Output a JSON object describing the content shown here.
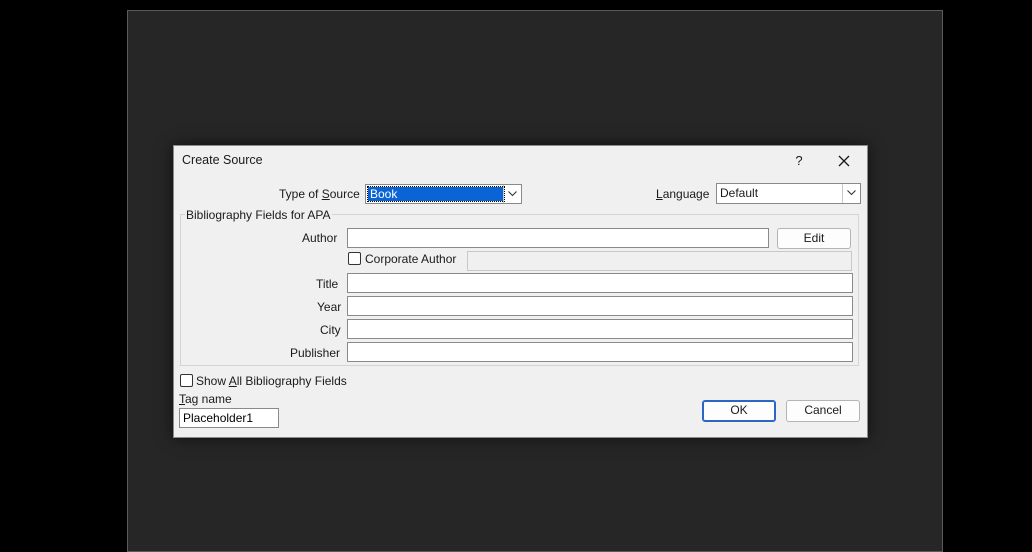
{
  "dialog": {
    "title": "Create Source",
    "help_label": "?",
    "type_of_source_prefix": "Type of ",
    "type_of_source_underline": "S",
    "type_of_source_suffix": "ource",
    "type_of_source_value": "Book",
    "language_underline": "L",
    "language_suffix": "anguage",
    "language_value": "Default",
    "group_title": "Bibliography Fields for APA",
    "fields": {
      "author_label": "Author",
      "edit_label": "Edit",
      "corporate_author_label": "Corporate Author",
      "title_label": "Title",
      "year_label": "Year",
      "city_label": "City",
      "publisher_label": "Publisher"
    },
    "show_all_prefix": "Show ",
    "show_all_underline": "A",
    "show_all_suffix": "ll Bibliography Fields",
    "tag_name_underline": "T",
    "tag_name_suffix": "ag name",
    "tag_name_value": "Placeholder1",
    "ok_label": "OK",
    "cancel_label": "Cancel"
  }
}
